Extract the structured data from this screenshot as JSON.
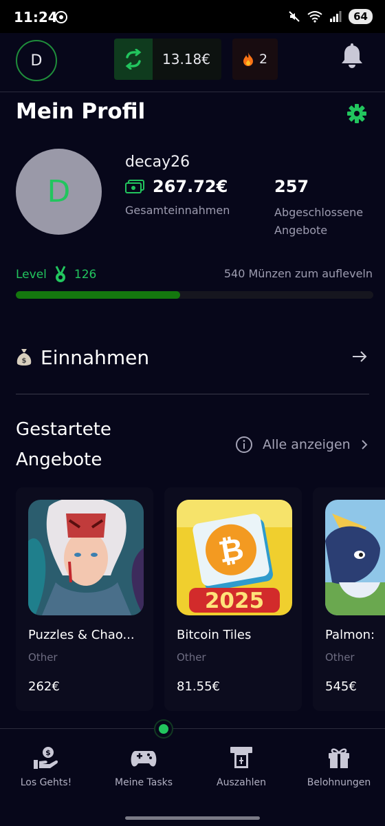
{
  "status_bar": {
    "time": "11:24",
    "battery": "64"
  },
  "header": {
    "avatar_initial": "D",
    "wallet_value": "13.18€",
    "streak_count": "2"
  },
  "profile": {
    "title": "Mein Profil",
    "avatar_initial": "D",
    "username": "decay26",
    "total_earnings_value": "267.72€",
    "total_earnings_label": "Gesamteinnahmen",
    "completed_offers_value": "257",
    "completed_offers_label": "Abgeschlossene Angebote",
    "level_label": "Level",
    "level_value": "126",
    "coins_to_level": "540 Münzen zum aufleveln",
    "level_progress_percent": 46
  },
  "earnings_section": {
    "label": "Einnahmen"
  },
  "started_offers": {
    "title": "Gestartete Angebote",
    "show_all": "Alle anzeigen",
    "cards": [
      {
        "title": "Puzzles & Chao...",
        "category": "Other",
        "price": "262€"
      },
      {
        "title": "Bitcoin Tiles",
        "category": "Other",
        "price": "81.55€",
        "badge": "2025"
      },
      {
        "title": "Palmon:",
        "category": "Other",
        "price": "545€"
      }
    ]
  },
  "bottom_nav": {
    "items": [
      {
        "label": "Los Gehts!"
      },
      {
        "label": "Meine Tasks"
      },
      {
        "label": "Auszahlen"
      },
      {
        "label": "Belohnungen"
      }
    ]
  },
  "colors": {
    "accent": "#22c55e",
    "background": "#07071a",
    "muted": "#9d9cb0"
  }
}
